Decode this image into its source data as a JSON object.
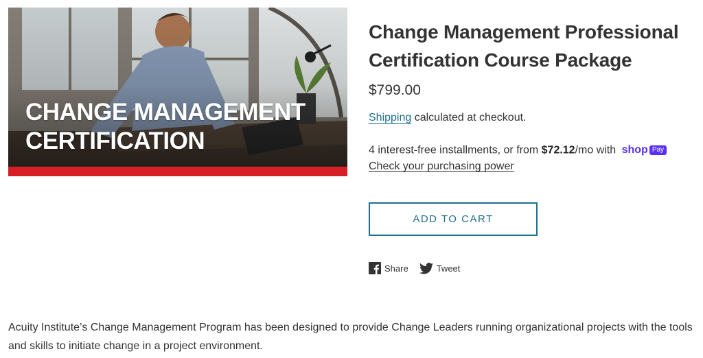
{
  "hero": {
    "headline_line1": "CHANGE MANAGEMENT",
    "headline_line2": "CERTIFICATION",
    "bar_color": "#d71f26"
  },
  "product": {
    "title": "Change Management Professional Certification Course Package",
    "price": "$799.00",
    "shipping_link": "Shipping",
    "shipping_rest": " calculated at checkout.",
    "installments_prefix": "4 interest-free installments, or from ",
    "installments_amount": "$72.12",
    "installments_suffix": "/mo with",
    "shop_word": "shop",
    "pay_badge": "Pay",
    "purchasing_power_link": "Check your purchasing power",
    "add_to_cart_label": "ADD TO CART"
  },
  "social": {
    "share_label": "Share",
    "tweet_label": "Tweet",
    "share_icon": "facebook-icon",
    "tweet_icon": "twitter-icon"
  },
  "description": "Acuity Institute’s Change Management Program has been designed to provide Change Leaders running organizational projects with the tools and skills to initiate change in a project environment.",
  "colors": {
    "accent": "#1e6f8f",
    "shop_purple": "#5a31f4",
    "hero_red": "#d71f26"
  }
}
